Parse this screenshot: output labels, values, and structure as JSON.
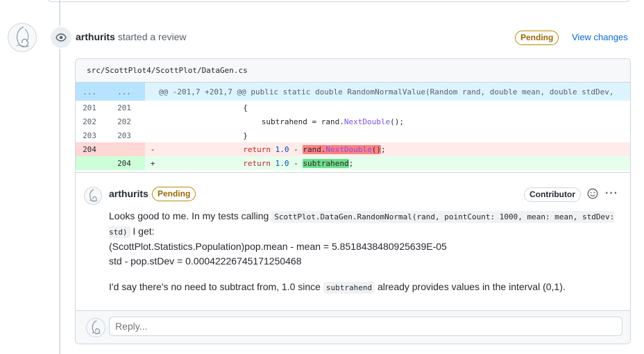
{
  "review": {
    "user": "arthurits",
    "action": "started a review",
    "status": "Pending",
    "view_changes": "View changes"
  },
  "file": {
    "path": "src/ScottPlot4/ScottPlot/DataGen.cs"
  },
  "diff": {
    "hunk_old": "...",
    "hunk_new": "...",
    "hunk_header": "@@ -201,7 +201,7 @@ public static double RandomNormalValue(Random rand, double mean, double stdDev,",
    "lines": [
      {
        "old": "201",
        "new": "201",
        "marker": "",
        "code": "            {"
      },
      {
        "old": "202",
        "new": "202",
        "marker": "",
        "code": "                subtrahend = rand.NextDouble();"
      },
      {
        "old": "203",
        "new": "203",
        "marker": "",
        "code": "            }"
      },
      {
        "old": "204",
        "new": "",
        "marker": "-",
        "code": "            return 1.0 - rand.NextDouble();"
      },
      {
        "old": "",
        "new": "204",
        "marker": "+",
        "code": "            return 1.0 - subtrahend;"
      }
    ]
  },
  "comment": {
    "user": "arthurits",
    "status": "Pending",
    "role": "Contributor",
    "line1_pre": "Looks good to me. In my tests calling ",
    "line1_code": "ScottPlot.DataGen.RandomNormal(rand, pointCount: 1000, mean: mean, stdDev: std)",
    "line1_post": " I get:",
    "line2": "(ScottPlot.Statistics.Population)pop.mean - mean = 5.8518438480925639E-05",
    "line3": "std - pop.stDev = 0.00042226745171250468",
    "line4_pre": "I'd say there's no need to subtract from, 1.0 since ",
    "line4_code": "subtrahend",
    "line4_post": " already provides values in the interval (0,1)."
  },
  "reply": {
    "placeholder": "Reply..."
  },
  "colors": {
    "accent": "#0969da",
    "pending": "#9a6700",
    "deletion_bg": "#ffebe9",
    "addition_bg": "#e6ffec",
    "hunk_bg": "#ddf4ff"
  },
  "icons": [
    "eye-icon",
    "smiley-icon",
    "kebab-horizontal-icon"
  ]
}
